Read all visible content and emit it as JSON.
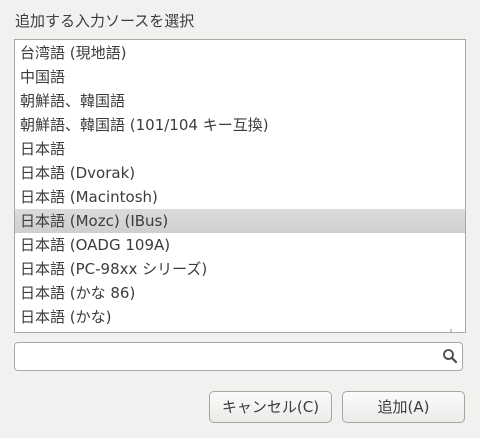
{
  "dialog": {
    "title": "追加する入力ソースを選択"
  },
  "input_sources": {
    "items": [
      "台湾語 (現地語)",
      "中国語",
      "朝鮮語、韓国語",
      "朝鮮語、韓国語 (101/104 キー互換)",
      "日本語",
      "日本語 (Dvorak)",
      "日本語 (Macintosh)",
      "日本語 (Mozc) (IBus)",
      "日本語 (OADG 109A)",
      "日本語 (PC-98xx シリーズ)",
      "日本語 (かな 86)",
      "日本語 (かな)"
    ],
    "selected_item": "日本語 (Mozc) (IBus)"
  },
  "search": {
    "value": "",
    "placeholder": "",
    "icon": "search-icon"
  },
  "buttons": {
    "cancel_label": "キャンセル(C)",
    "add_label": "追加(A)"
  }
}
